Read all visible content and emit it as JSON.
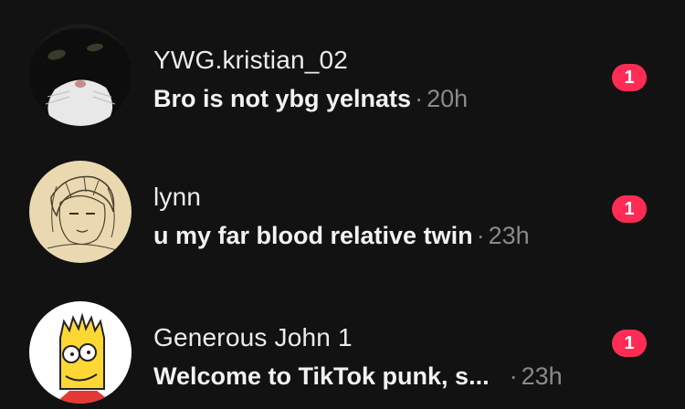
{
  "conversations": [
    {
      "name": "YWG.kristian_02",
      "message": "Bro is not ybg yelnats",
      "separator": "·",
      "time": "20h",
      "unread": "1",
      "avatar_icon": "cat-avatar-icon"
    },
    {
      "name": "lynn",
      "message": "u my far blood relative twin",
      "separator": "·",
      "time": "23h",
      "unread": "1",
      "avatar_icon": "sketch-avatar-icon"
    },
    {
      "name": "Generous John 1",
      "message": "Welcome to TikTok punk, s...",
      "separator": "·",
      "time": "23h",
      "unread": "1",
      "avatar_icon": "bart-avatar-icon"
    }
  ],
  "colors": {
    "background": "#121212",
    "badge": "#fe2c55",
    "secondary_text": "#8a8a8a"
  }
}
